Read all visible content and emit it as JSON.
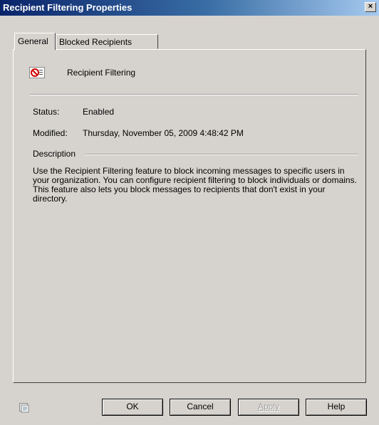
{
  "window": {
    "title": "Recipient Filtering Properties",
    "close_glyph": "×"
  },
  "tabs": [
    {
      "label": "General",
      "active": true
    },
    {
      "label": "Blocked Recipients",
      "active": false
    }
  ],
  "general": {
    "feature_name": "Recipient Filtering",
    "status_label": "Status:",
    "status_value": "Enabled",
    "modified_label": "Modified:",
    "modified_value": "Thursday, November 05, 2009 4:48:42 PM",
    "description_label": "Description",
    "description_text": "Use the Recipient Filtering feature to block incoming messages to specific users in your organization. You can configure recipient filtering to block individuals or domains. This feature also lets you block messages to recipients that don't exist in your directory."
  },
  "buttons": {
    "ok": "OK",
    "cancel": "Cancel",
    "apply": "Apply",
    "help": "Help"
  },
  "icons": {
    "feature": "recipient-filter-icon",
    "help_context": "help-context-icon"
  },
  "colors": {
    "dialog_bg": "#d6d3ce",
    "title_start": "#0a246a",
    "title_end": "#a6caf0",
    "filter_red": "#d40000"
  }
}
